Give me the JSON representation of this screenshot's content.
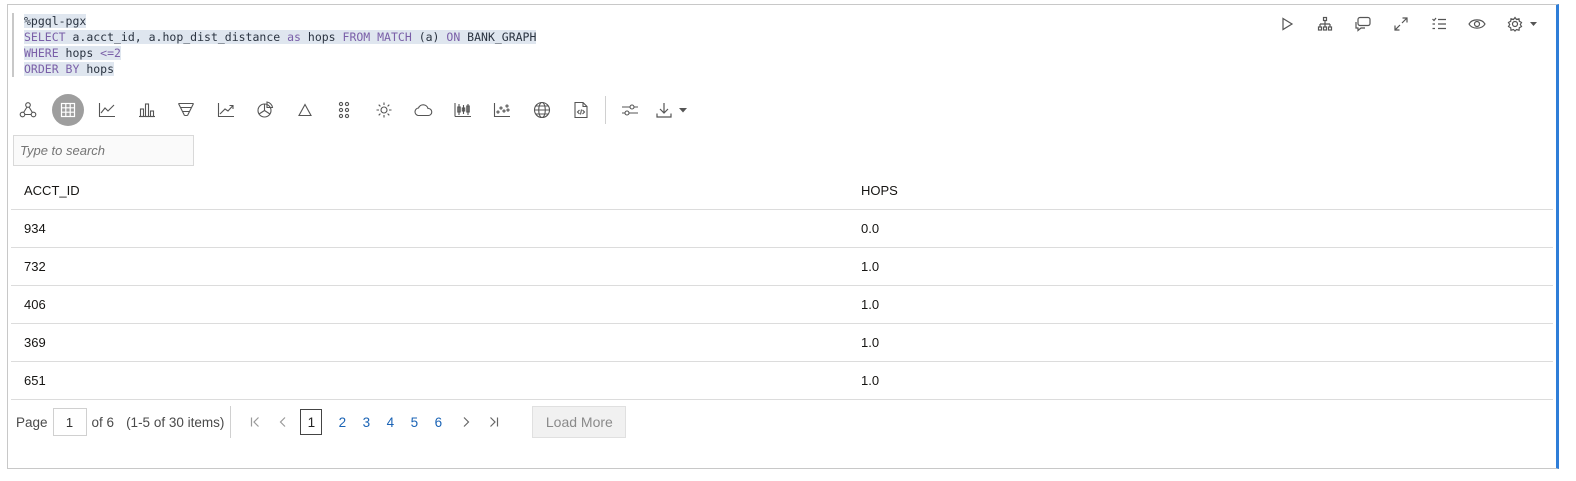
{
  "paragraph": {
    "code_lines": [
      [
        {
          "t": "%pgql-pgx",
          "c": "tx"
        }
      ],
      [
        {
          "t": "SELECT",
          "c": "kw"
        },
        {
          "t": " a.acct_id, a.hop_dist_distance ",
          "c": "tx"
        },
        {
          "t": "as",
          "c": "kw"
        },
        {
          "t": " hops ",
          "c": "tx"
        },
        {
          "t": "FROM MATCH",
          "c": "kw"
        },
        {
          "t": " (a) ",
          "c": "tx"
        },
        {
          "t": "ON",
          "c": "kw"
        },
        {
          "t": " BANK_GRAPH",
          "c": "tx"
        }
      ],
      [
        {
          "t": "WHERE",
          "c": "kw"
        },
        {
          "t": " hops ",
          "c": "tx"
        },
        {
          "t": "<=2",
          "c": "kw"
        }
      ],
      [
        {
          "t": "ORDER BY",
          "c": "kw"
        },
        {
          "t": " hops",
          "c": "tx"
        }
      ]
    ],
    "actions": [
      "run-icon",
      "hierarchy-icon",
      "comment-icon",
      "expand-icon",
      "list-icon",
      "eye-icon",
      "settings-icon"
    ]
  },
  "viz_toolbar": {
    "buttons": [
      "graph-icon",
      "table-icon",
      "line-chart-icon",
      "bar-chart-icon",
      "funnel-icon",
      "trend-icon",
      "pie-chart-icon",
      "triangle-icon",
      "dots-grid-icon",
      "sun-icon",
      "cloud-icon",
      "candlestick-icon",
      "scatter-icon",
      "globe-icon",
      "code-file-icon"
    ],
    "active": "table-icon",
    "extras": [
      "settings-sliders-icon",
      "download-icon"
    ]
  },
  "search": {
    "placeholder": "Type to search",
    "value": ""
  },
  "table": {
    "columns": [
      "ACCT_ID",
      "HOPS"
    ],
    "rows": [
      [
        "934",
        "0.0"
      ],
      [
        "732",
        "1.0"
      ],
      [
        "406",
        "1.0"
      ],
      [
        "369",
        "1.0"
      ],
      [
        "651",
        "1.0"
      ]
    ]
  },
  "pager": {
    "page_label": "Page",
    "current_page": "1",
    "of_label": "of 6",
    "range_label": "(1-5 of 30 items)",
    "pages": [
      "1",
      "2",
      "3",
      "4",
      "5",
      "6"
    ],
    "load_more": "Load More"
  },
  "colors": {
    "accent": "#2f7ed8",
    "keyword": "#7a5fa8",
    "highlight": "#dfe6ef",
    "link": "#1a63b5"
  }
}
